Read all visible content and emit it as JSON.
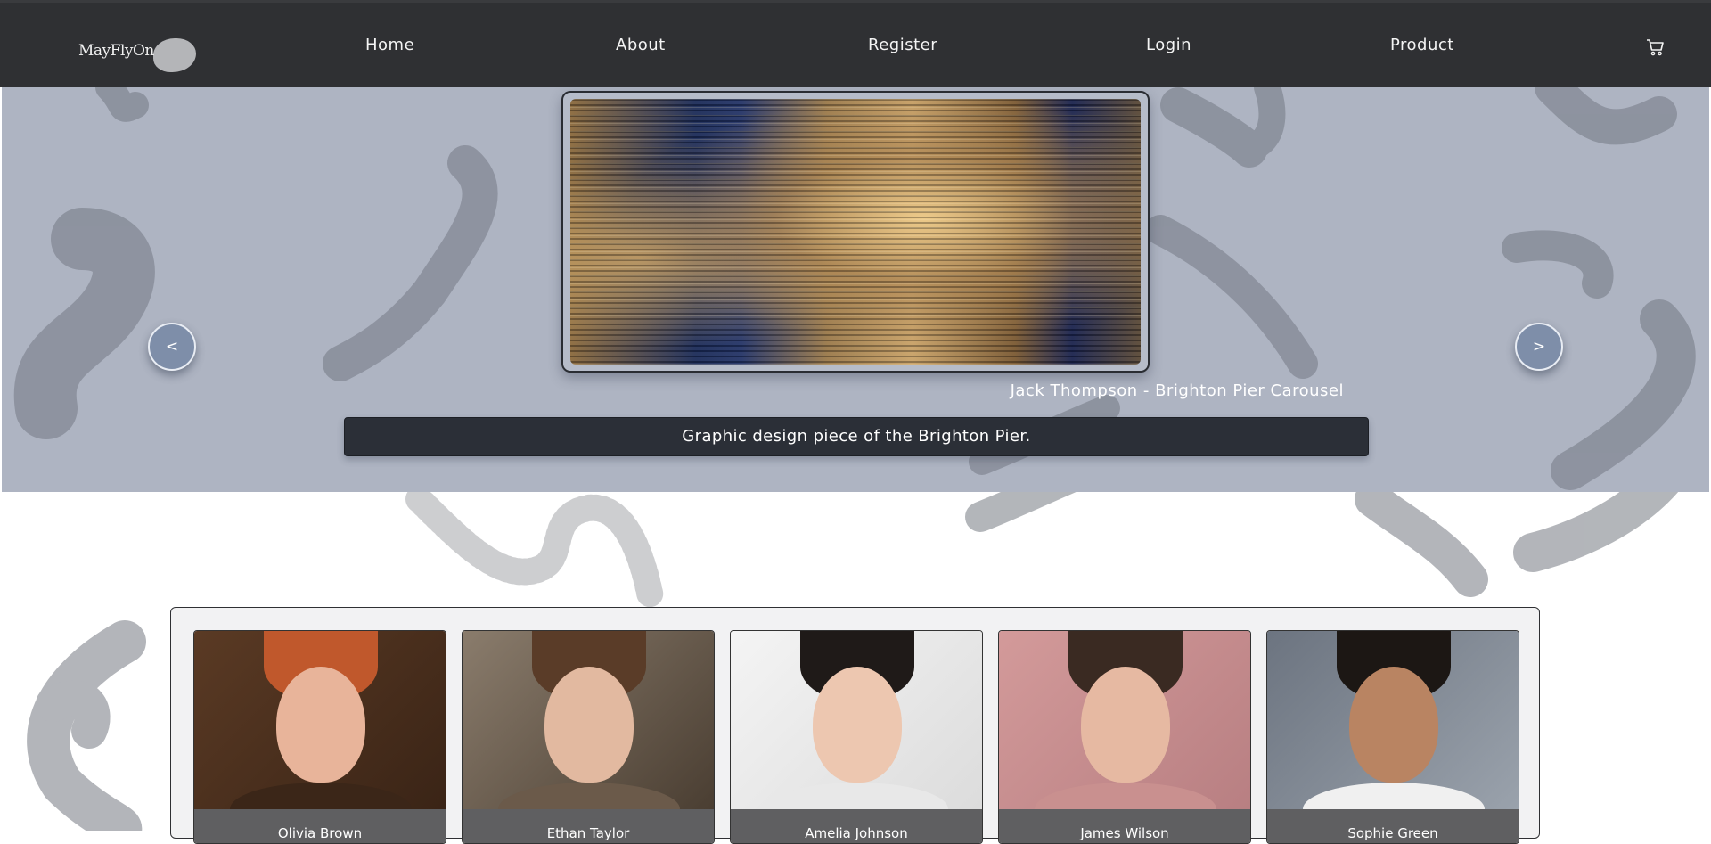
{
  "brand": {
    "name": "MayFlyOn"
  },
  "nav": {
    "links": [
      {
        "label": "Home"
      },
      {
        "label": "About"
      },
      {
        "label": "Register"
      },
      {
        "label": "Login"
      },
      {
        "label": "Product"
      }
    ],
    "cart_icon": "shopping-cart-icon"
  },
  "carousel": {
    "prev_label": "<",
    "next_label": ">",
    "artwork_title": "Jack Thompson - Brighton Pier Carousel",
    "description": "Graphic design piece of the Brighton Pier."
  },
  "team": {
    "members": [
      {
        "name": "Olivia Brown"
      },
      {
        "name": "Ethan Taylor"
      },
      {
        "name": "Amelia Johnson"
      },
      {
        "name": "James Wilson"
      },
      {
        "name": "Sophie Green"
      }
    ]
  },
  "colors": {
    "navbar": "#2f3033",
    "hero_background": "#aeb4c2",
    "caption_box": "#2b2f37",
    "arrow_button": "#7e8ea9"
  }
}
